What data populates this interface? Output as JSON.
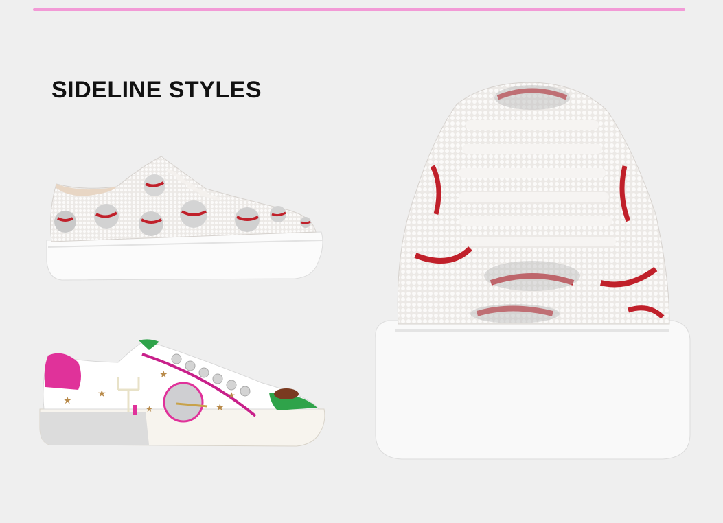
{
  "header": {
    "title": "SIDELINE STYLES"
  },
  "colors": {
    "accent_rule": "#f29ad6",
    "background": "#efefef",
    "text": "#111111"
  },
  "products": [
    {
      "name": "baseball-rhinestone-sneaker-side",
      "colors": [
        "white",
        "red",
        "silver"
      ]
    },
    {
      "name": "football-embellished-sneaker-side",
      "colors": [
        "white",
        "pink",
        "green"
      ]
    },
    {
      "name": "baseball-rhinestone-sneaker-front",
      "colors": [
        "white",
        "red",
        "silver"
      ]
    }
  ]
}
